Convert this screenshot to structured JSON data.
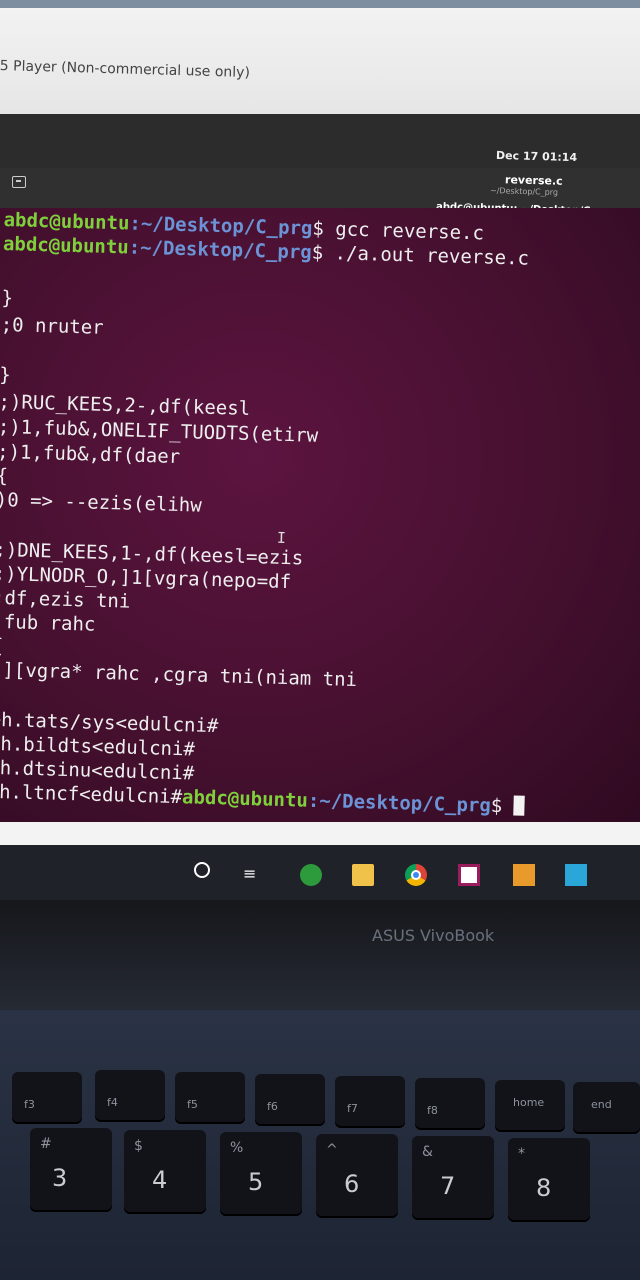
{
  "vm_window": {
    "title": "5 Player (Non-commercial use only)"
  },
  "topbar": {
    "clock": "Dec 17  01:14"
  },
  "terminal_window": {
    "title": "reverse.c",
    "subtitle": "~/Desktop/C_prg",
    "tab": "abdc@ubuntu: ~/Desktop/C_prg"
  },
  "terminal": {
    "prompt_user": "abdc@ubuntu",
    "prompt_path": ":~/Desktop/C_prg",
    "prompt_end": "$",
    "cmd1": " gcc reverse.c",
    "cmd2": " ./a.out reverse.c",
    "output": [
      "}",
      ";0 nruter",
      "",
      "}",
      ";)RUC_KEES,2-,df(keesl",
      ";)1,fub&,ONELIF_TUODTS(etirw",
      ";)1,fub&,df(daer",
      "{",
      ")0 => --ezis(elihw",
      "",
      ";)DNE_KEES,1-,df(keesl=ezis",
      ";)YLNODR_O,]1[vgra(nepo=df",
      ";df,ezis tni",
      ";fub rahc",
      "{",
      ")][vgra* rahc ,cgra tni(niam tni",
      "",
      ">h.tats/sys<edulcni#",
      ">h.bildts<edulcni#",
      ">h.dtsinu<edulcni#"
    ],
    "last_output": ">h.ltncf<edulcni#",
    "last_prompt_user": "abdc@ubuntu",
    "last_prompt_path": ":~/Desktop/C_prg",
    "last_prompt_end": "$ ",
    "text_cursor": "I"
  },
  "taskbar": {
    "icons": [
      "search-icon",
      "task-view-icon",
      "app-icon",
      "file-explorer-icon",
      "chrome-icon",
      "vmware-icon",
      "app-icon",
      "app-icon"
    ],
    "taskview_glyph": "≡"
  },
  "laptop": {
    "brand": "ASUS VivoBook"
  },
  "keyboard": {
    "fkeys": [
      {
        "label": "f3"
      },
      {
        "label": "f4"
      },
      {
        "label": "f5"
      },
      {
        "label": "f6"
      },
      {
        "label": "f7"
      },
      {
        "label": "f8"
      },
      {
        "label": "home"
      },
      {
        "label": "end"
      }
    ],
    "numkeys": [
      {
        "main": "3",
        "top": "#"
      },
      {
        "main": "4",
        "top": "$"
      },
      {
        "main": "5",
        "top": "%"
      },
      {
        "main": "6",
        "top": "^"
      },
      {
        "main": "7",
        "top": "&"
      },
      {
        "main": "8",
        "top": "*"
      }
    ]
  }
}
